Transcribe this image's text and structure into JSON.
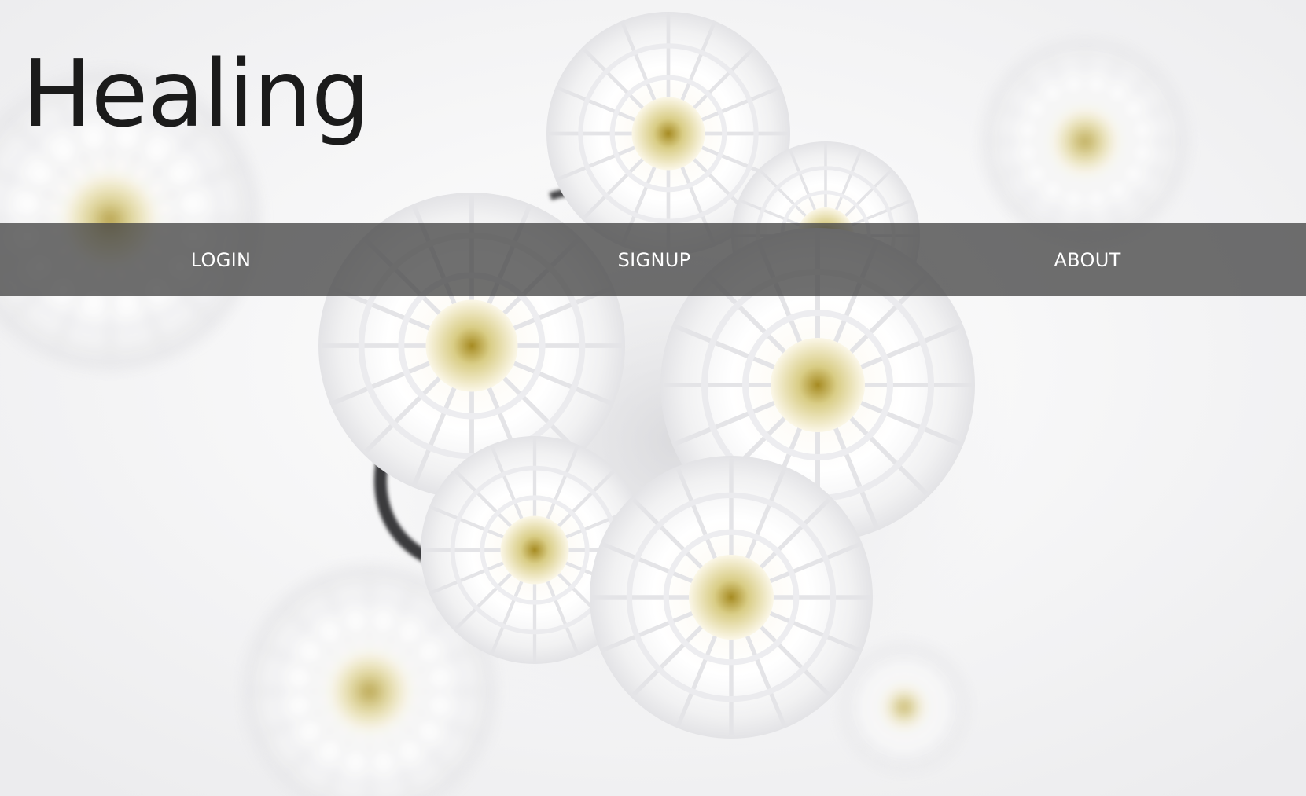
{
  "hero": {
    "title": "Healing"
  },
  "nav": {
    "items": [
      {
        "label": "LOGIN"
      },
      {
        "label": "SIGNUP"
      },
      {
        "label": "ABOUT"
      }
    ]
  },
  "colors": {
    "background": "#f2f2f3",
    "title": "#1b1b1b",
    "navbar": "#464646",
    "nav_text": "#ffffff",
    "flower_center": "#c9b24a"
  }
}
